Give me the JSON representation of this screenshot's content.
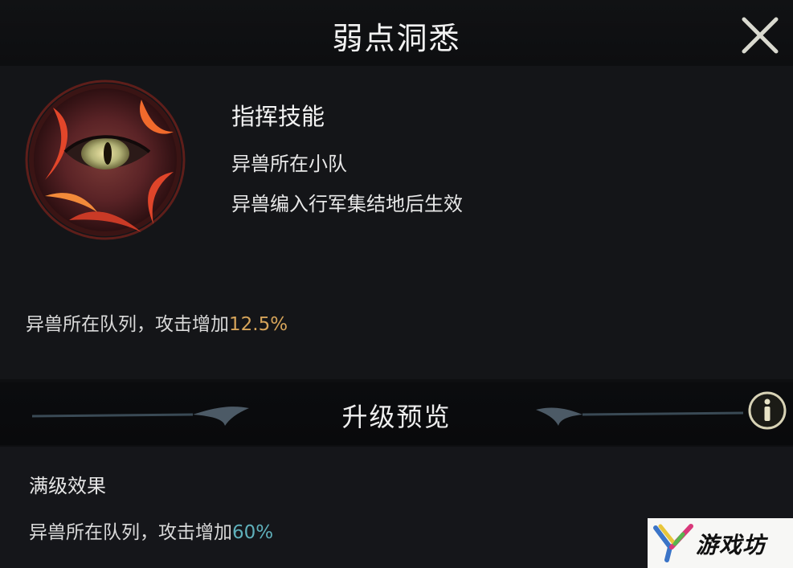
{
  "header": {
    "title": "弱点洞悉"
  },
  "skill": {
    "name": "指挥技能",
    "scope": "异兽所在小队",
    "condition": "异兽编入行军集结地后生效",
    "current_effect_text": "异兽所在队列，攻击增加",
    "current_effect_value": "12.5%"
  },
  "upgrade_preview": {
    "title": "升级预览",
    "max_label": "满级效果",
    "max_effect_text": "异兽所在队列，攻击增加",
    "max_effect_value": "60%"
  },
  "watermark": {
    "text": "游戏坊"
  },
  "icons": {
    "close": "close-icon",
    "info": "info-icon",
    "skill": "beast-eye-icon"
  },
  "colors": {
    "value_gold": "#d6a45a",
    "value_teal": "#5fb0bb",
    "background": "#0e0f11"
  }
}
